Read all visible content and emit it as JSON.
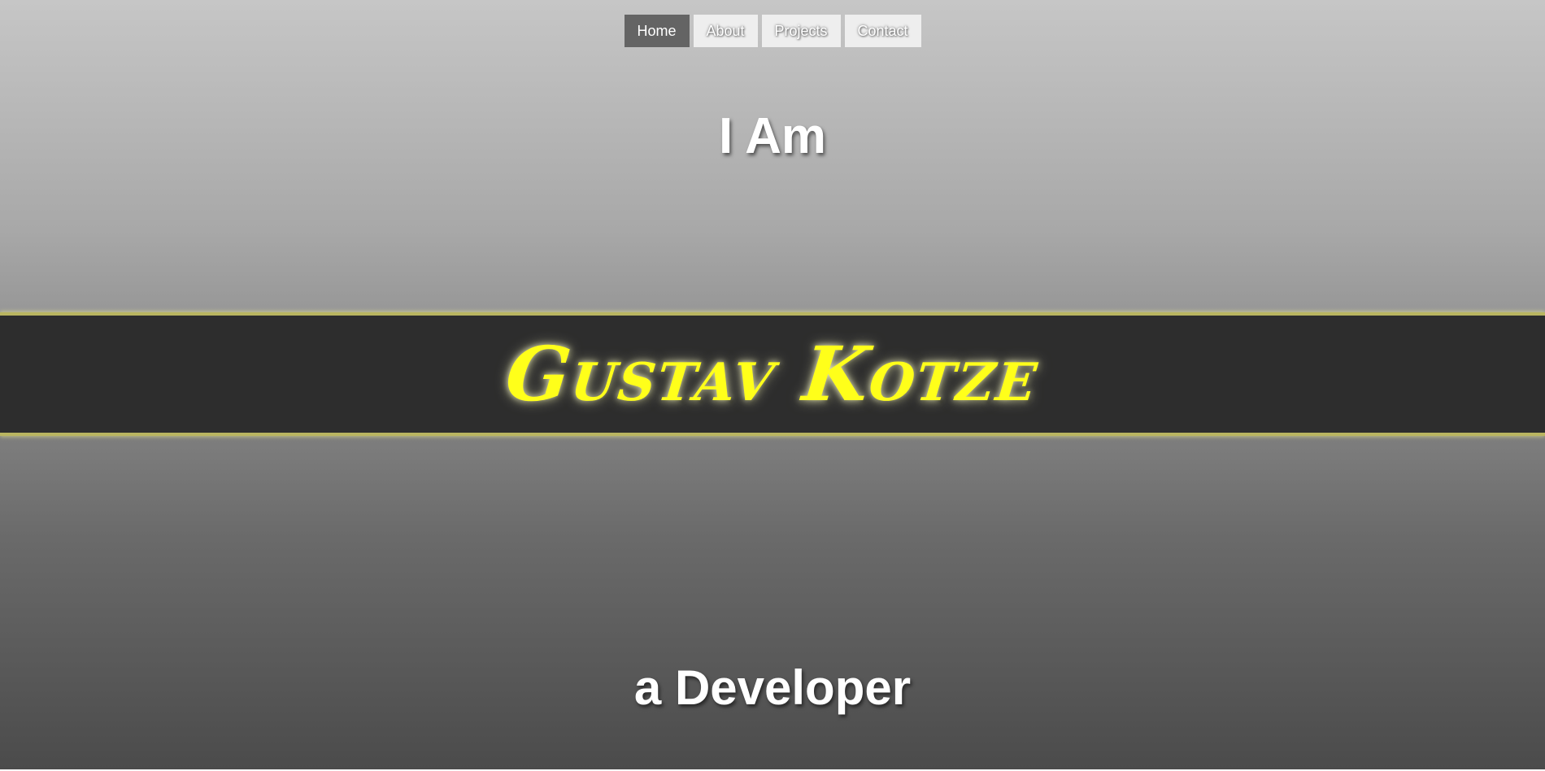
{
  "nav": {
    "items": [
      {
        "label": "Home",
        "active": true
      },
      {
        "label": "About",
        "active": false
      },
      {
        "label": "Projects",
        "active": false
      },
      {
        "label": "Contact",
        "active": false
      }
    ]
  },
  "hero": {
    "intro": "I Am",
    "name": "Gustav Kotze",
    "role": "a Developer"
  },
  "colors": {
    "name_accent": "#ffff1a",
    "band_background": "#2d2d2d",
    "band_border": "#b9b560",
    "active_nav_background": "#646464",
    "nav_background": "#eeeeee"
  }
}
